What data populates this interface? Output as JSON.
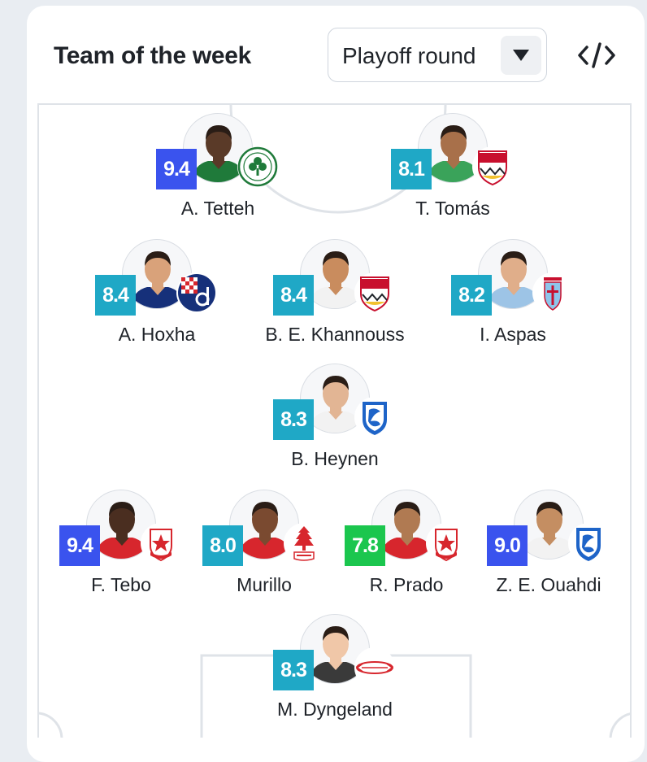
{
  "header": {
    "title": "Team of the week",
    "round_select": {
      "selected": "Playoff round"
    }
  },
  "colors": {
    "rating_high": "#3a53ee",
    "rating_good": "#1fa8c6",
    "rating_ok": "#1bc64e"
  },
  "players": [
    {
      "name": "A. Tetteh",
      "rating": "9.4",
      "rating_color": "#3a53ee",
      "skin": "#5a3a28",
      "shirt": "#1f7a3a",
      "club_icon": "panathinaikos-crest-icon"
    },
    {
      "name": "T. Tomás",
      "rating": "8.1",
      "rating_color": "#1fa8c6",
      "skin": "#a8704a",
      "shirt": "#3aa35a",
      "club_icon": "vfb-stuttgart-crest-icon"
    },
    {
      "name": "A. Hoxha",
      "rating": "8.4",
      "rating_color": "#1fa8c6",
      "skin": "#d9a27a",
      "shirt": "#16307a",
      "club_icon": "dinamo-zagreb-crest-icon"
    },
    {
      "name": "B. E. Khannouss",
      "rating": "8.4",
      "rating_color": "#1fa8c6",
      "skin": "#c98c5e",
      "shirt": "#f2f2f2",
      "club_icon": "vfb-stuttgart-crest-icon"
    },
    {
      "name": "I. Aspas",
      "rating": "8.2",
      "rating_color": "#1fa8c6",
      "skin": "#e0ae8a",
      "shirt": "#9dc4e6",
      "club_icon": "celta-vigo-crest-icon"
    },
    {
      "name": "B. Heynen",
      "rating": "8.3",
      "rating_color": "#1fa8c6",
      "skin": "#e2b594",
      "shirt": "#f2f2f2",
      "club_icon": "genk-crest-icon"
    },
    {
      "name": "F. Tebo",
      "rating": "9.4",
      "rating_color": "#3a53ee",
      "skin": "#4a2e20",
      "shirt": "#d7262d",
      "club_icon": "red-star-crest-icon"
    },
    {
      "name": "Murillo",
      "rating": "8.0",
      "rating_color": "#1fa8c6",
      "skin": "#7a4a30",
      "shirt": "#d7262d",
      "club_icon": "nottingham-forest-crest-icon"
    },
    {
      "name": "R. Prado",
      "rating": "7.8",
      "rating_color": "#1bc64e",
      "skin": "#b07a52",
      "shirt": "#d7262d",
      "club_icon": "red-star-crest-icon"
    },
    {
      "name": "Z. E. Ouahdi",
      "rating": "9.0",
      "rating_color": "#3a53ee",
      "skin": "#c48e62",
      "shirt": "#f2f2f2",
      "club_icon": "genk-crest-icon"
    },
    {
      "name": "M. Dyngeland",
      "rating": "8.3",
      "rating_color": "#1fa8c6",
      "skin": "#f0c7a8",
      "shirt": "#3a3a3a",
      "club_icon": "brann-crest-icon"
    }
  ]
}
